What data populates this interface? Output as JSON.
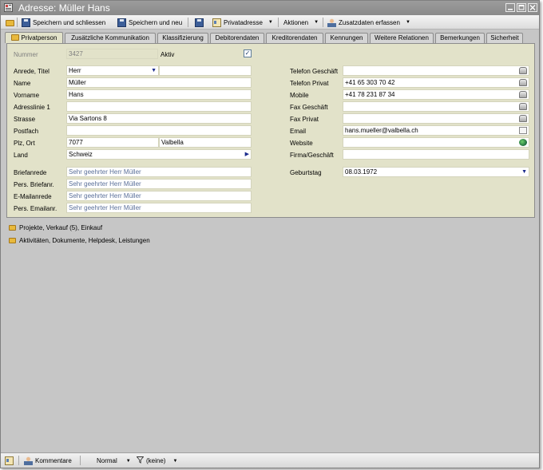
{
  "window": {
    "title": "Adresse: Müller Hans",
    "controls": [
      "minimize-icon",
      "maximize-icon",
      "close-icon"
    ]
  },
  "toolbar": {
    "save_close_label": "Speichern und schliessen",
    "save_new_label": "Speichern und neu",
    "private_address_label": "Privatadresse",
    "actions_label": "Aktionen",
    "extra_data_label": "Zusatzdaten erfassen"
  },
  "tabs": [
    "Privatperson",
    "Zusätzliche Kommunikation",
    "Klassifizierung",
    "Debitorendaten",
    "Kreditorendaten",
    "Kennungen",
    "Weitere Relationen",
    "Bemerkungen",
    "Sicherheit"
  ],
  "form": {
    "nummer": {
      "label": "Nummer",
      "value": "3427"
    },
    "aktiv": {
      "label": "Aktiv",
      "checked": true
    },
    "anrede": {
      "label": "Anrede, Titel",
      "value": "Herr",
      "title_value": ""
    },
    "name": {
      "label": "Name",
      "value": "Müller"
    },
    "vorname": {
      "label": "Vorname",
      "value": "Hans"
    },
    "adresslinie1": {
      "label": "Adresslinie 1",
      "value": ""
    },
    "strasse": {
      "label": "Strasse",
      "value": "Via Sartons 8"
    },
    "postfach": {
      "label": "Postfach",
      "value": ""
    },
    "plz_ort": {
      "label": "Plz, Ort",
      "plz": "7077",
      "ort": "Valbella"
    },
    "land": {
      "label": "Land",
      "value": "Schweiz"
    },
    "briefanrede": {
      "label": "Briefanrede",
      "value": "Sehr geehrter Herr Müller"
    },
    "pers_briefanrede": {
      "label": "Pers. Briefanr.",
      "value": "Sehr geehrter Herr Müller"
    },
    "emailanrede": {
      "label": "E-Mailanrede",
      "value": "Sehr geehrter Herr Müller"
    },
    "pers_emailanrede": {
      "label": "Pers. Emailanr.",
      "value": "Sehr geehrter Herr Müller"
    },
    "telefon_geschaeft": {
      "label": "Telefon Geschäft",
      "value": ""
    },
    "telefon_privat": {
      "label": "Telefon Privat",
      "value": "+41 65 303 70 42"
    },
    "mobile": {
      "label": "Mobile",
      "value": "+41 78 231 87 34"
    },
    "fax_geschaeft": {
      "label": "Fax Geschäft",
      "value": ""
    },
    "fax_privat": {
      "label": "Fax Privat",
      "value": ""
    },
    "email": {
      "label": "Email",
      "value": "hans.mueller@valbella.ch"
    },
    "website": {
      "label": "Website",
      "value": ""
    },
    "firma": {
      "label": "Firma/Geschäft",
      "value": ""
    },
    "geburtstag": {
      "label": "Geburtstag",
      "value": "08.03.1972"
    }
  },
  "sections": [
    "Projekte, Verkauf (5), Einkauf",
    "Aktivitäten, Dokumente, Helpdesk, Leistungen"
  ],
  "statusbar": {
    "comments_label": "Kommentare",
    "priority_value": "Normal",
    "filter_value": "(keine)"
  }
}
